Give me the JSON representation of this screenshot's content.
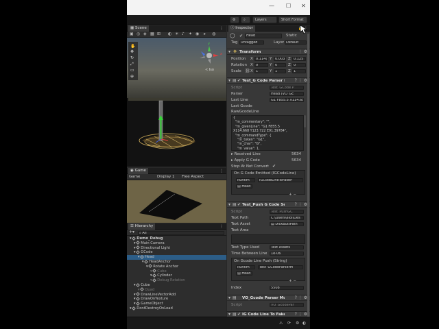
{
  "toolbar": {
    "layers": "Layers",
    "layout": "Short Format"
  },
  "scene": {
    "tab": "Scene",
    "y_label": "y",
    "x_label": "x",
    "iso": "< Iso"
  },
  "game": {
    "tab": "Game",
    "mode": "Game",
    "display": "Display 1",
    "aspect": "Free Aspect"
  },
  "hierarchy": {
    "tab": "Hierarchy",
    "search_placeholder": "All",
    "rows": [
      {
        "label": "Demo_Debug",
        "indent": 0,
        "bold": true
      },
      {
        "label": "Main Camera",
        "indent": 1
      },
      {
        "label": "Directional Light",
        "indent": 1
      },
      {
        "label": "GCode",
        "indent": 1
      },
      {
        "label": "Head",
        "indent": 2,
        "selected": true
      },
      {
        "label": "HeadAnchor",
        "indent": 3
      },
      {
        "label": "Rotate Anchor",
        "indent": 4
      },
      {
        "label": "Cube",
        "indent": 5,
        "dim": true
      },
      {
        "label": "Cylinder",
        "indent": 5
      },
      {
        "label": "Debug Rotation",
        "indent": 5,
        "dim": true
      },
      {
        "label": "Cube",
        "indent": 1
      },
      {
        "label": "Quad",
        "indent": 2,
        "dim": true
      },
      {
        "label": "DrawLineVectorAdd",
        "indent": 1
      },
      {
        "label": "DrawOnTexture",
        "indent": 1
      },
      {
        "label": "GameObject",
        "indent": 1
      },
      {
        "label": "DontDestroyOnLoad",
        "indent": 0
      }
    ]
  },
  "inspector": {
    "tab": "Inspector",
    "object_name": "Head",
    "static_label": "Static",
    "tag_label": "Tag",
    "tag_value": "Untagged",
    "layer_label": "Layer",
    "layer_value": "Default",
    "transform": {
      "title": "Transform",
      "position_label": "Position",
      "pos_x": "0.114(",
      "pos_y": "0.003",
      "pos_z": "0.125",
      "rotation_label": "Rotation",
      "rot_x": "0",
      "rot_y": "0",
      "rot_z": "0",
      "scale_label": "Scale",
      "sc_x": "1",
      "sc_y": "1",
      "sc_z": "1"
    },
    "parser": {
      "title": "Test_G Code Parser M",
      "script_label": "Script",
      "script_value": "Test_GCode P",
      "parser_label": "Parser",
      "parser_value": "Head (VO_Gc",
      "lastline_label": "Last Line",
      "lastline_value": "G1 F855.5 X114.65",
      "lastgcode_label": "Last Gcode",
      "raw_label": "RawGcodeLine",
      "raw_lines": [
        "{",
        "  \"m_commentary\": \"\",",
        "  \"m_givenLine\": \"G1 F855.5",
        "X114.668 Y123.722 E91.39784\",",
        "  \"m_commandType\": {",
        "    \"m_token\": \"G1\",",
        "    \"m_char\": \"G\",",
        "    \"m_value\": 1,"
      ],
      "received_label": "Received Line",
      "received_value": "5634",
      "apply_label": "Apply G Code",
      "apply_value": "5634",
      "stop_label": "Stop At Not Convert",
      "event_label": "On G Code Emitted (IGCodeLine)",
      "runtime_label": "Runtim",
      "func_label": "IGCodeLineToFakeP",
      "obj_label": "Head"
    },
    "push": {
      "title": "Test_Push G Code Se",
      "script_label": "Script",
      "script_value": "Test_PushGC",
      "textpath_label": "Text Path",
      "textpath_value": "C:\\Users\\eloi\\Des",
      "textasset_label": "Text Asset",
      "textasset_value": "DickButtPath",
      "textarea_label": "Text Area",
      "texttype_label": "Text Type Used",
      "texttype_value": "Text Assets",
      "time_label": "Time Between Line",
      "time_value": "1e-06",
      "event_label": "On Gcode Line Push (String)",
      "runtime_label": "Runtim",
      "func_label": "Test_GCodeParserM",
      "obj_label": "Head",
      "index_label": "Index",
      "index_value": "5508"
    },
    "vo": {
      "title": "VO_Gcode Parser Mor",
      "script_label": "Script",
      "script_value": "VO_GcodePar"
    },
    "fake": {
      "title": "IG Code Line To Fake F"
    }
  },
  "colors": {
    "accent": "#2c5d87",
    "selected_text": "#4fc3f7"
  }
}
